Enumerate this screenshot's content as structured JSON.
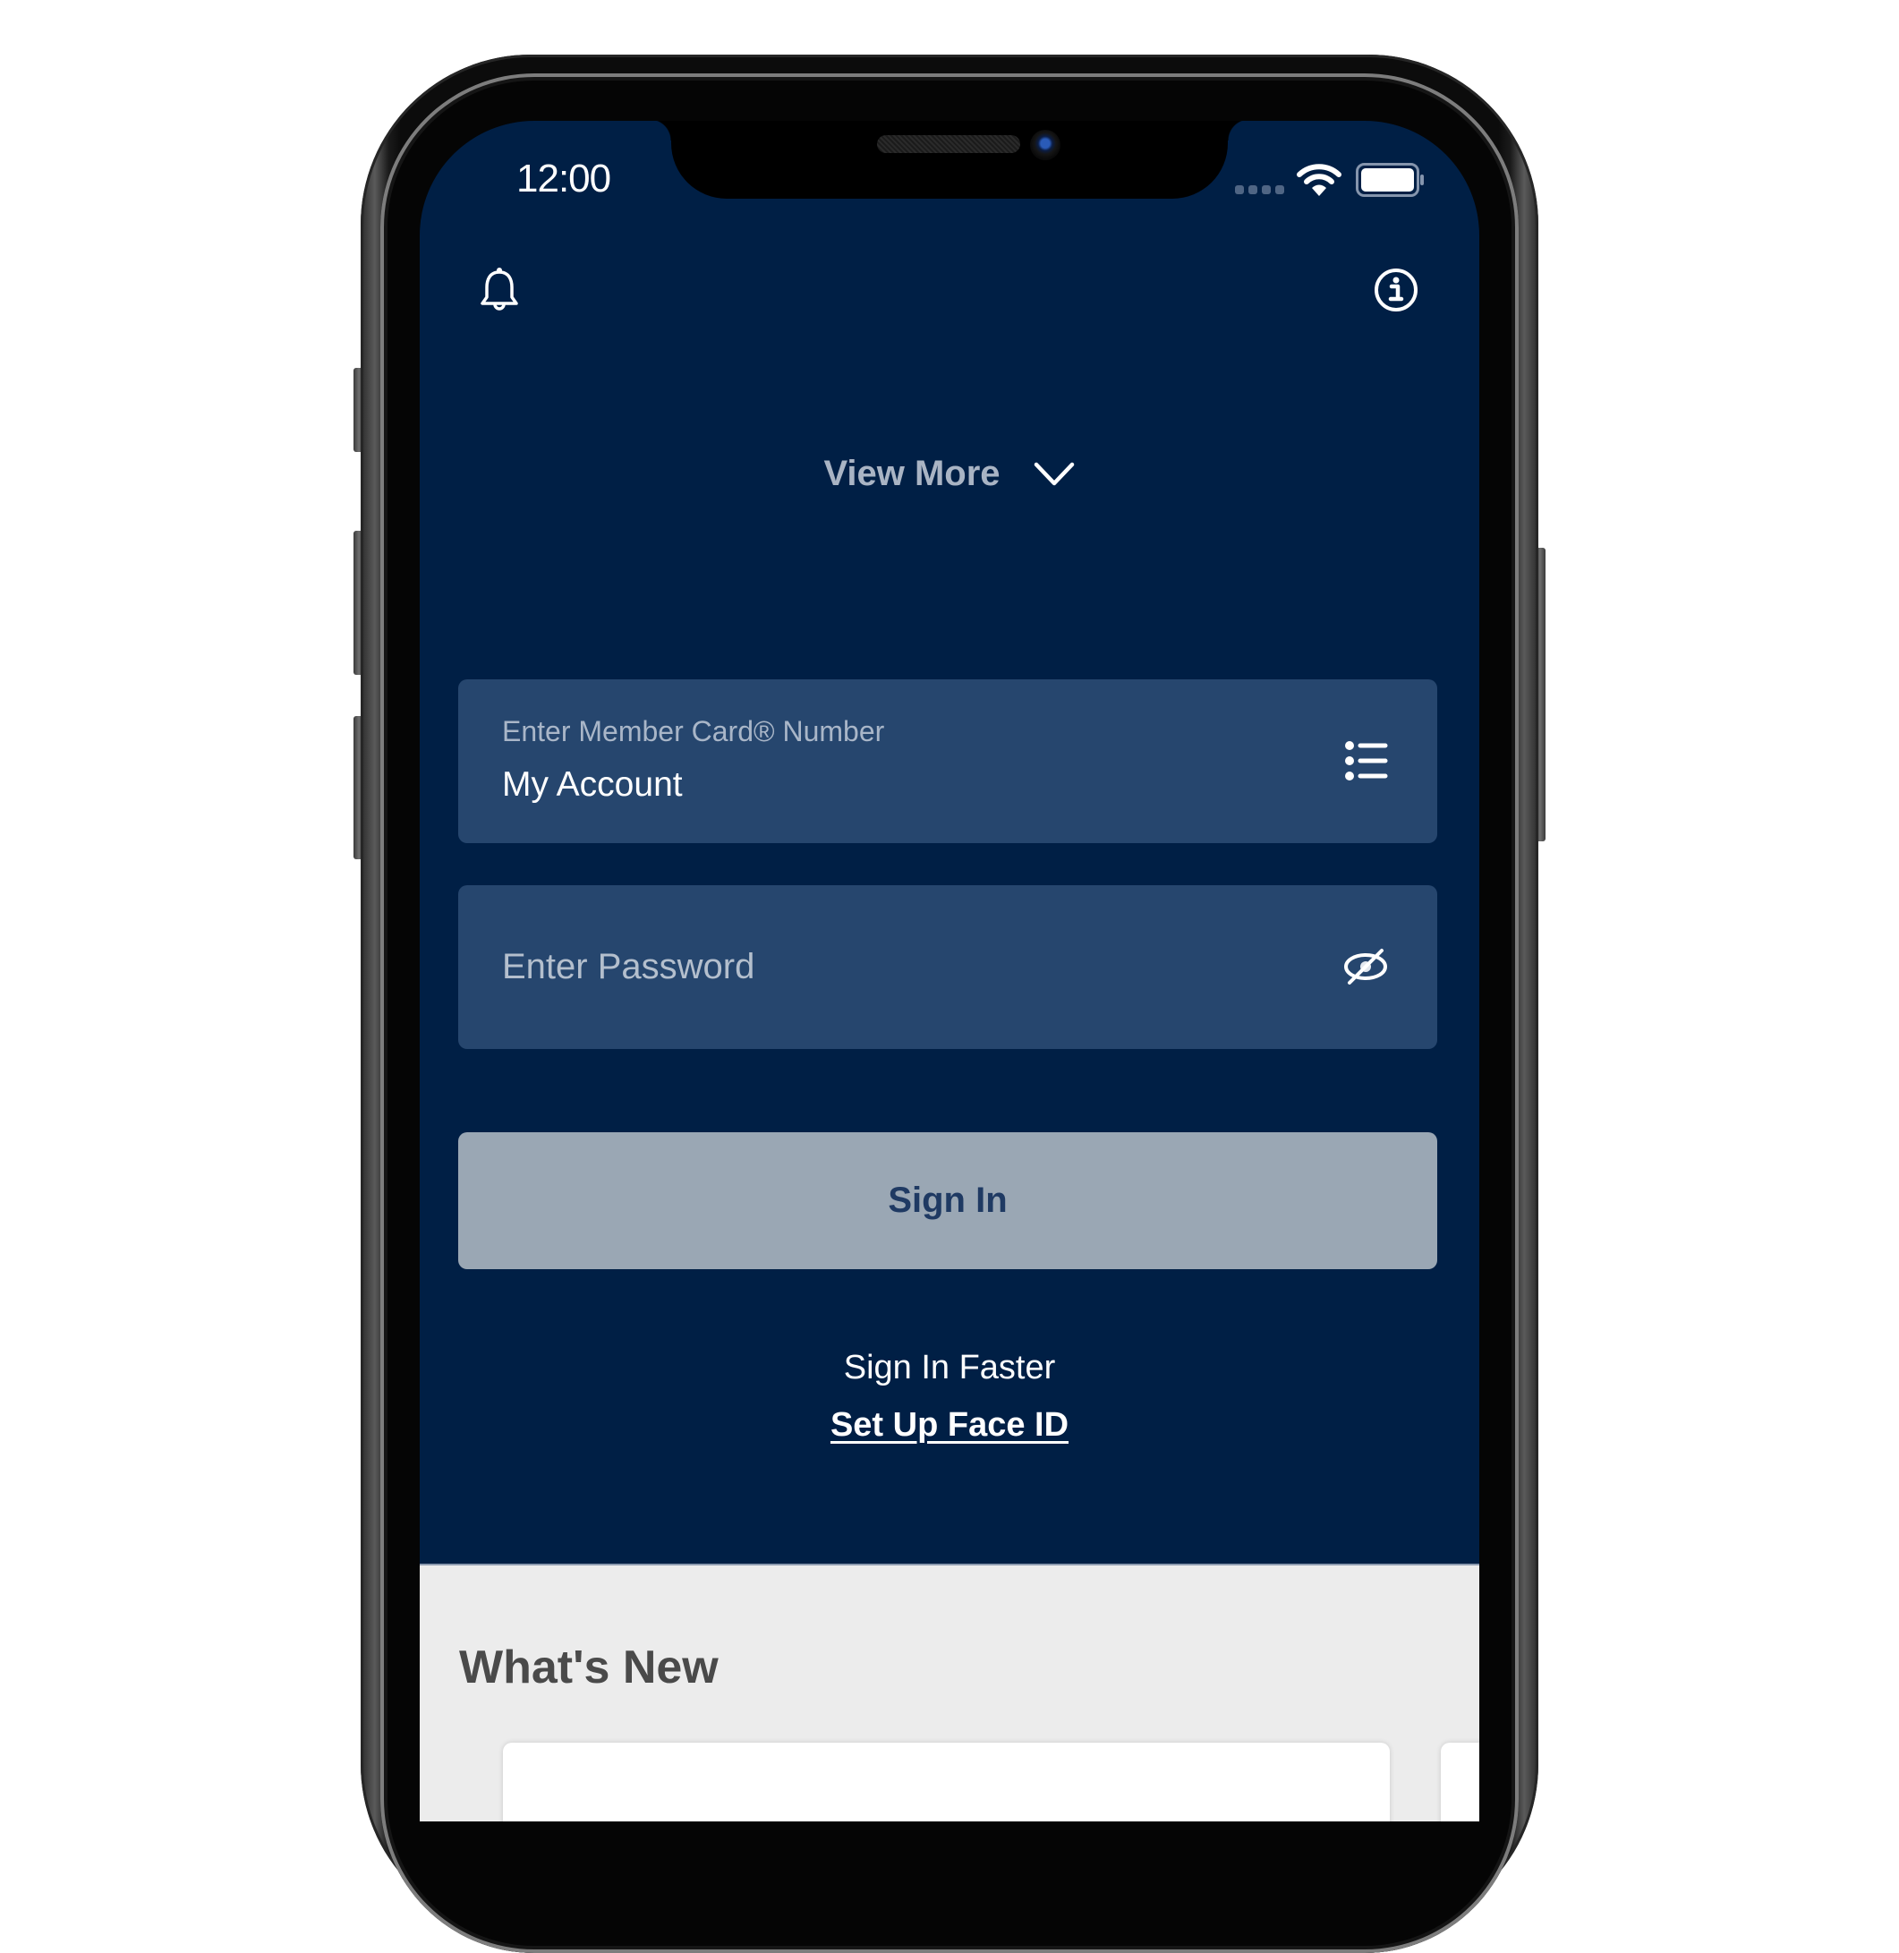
{
  "status_bar": {
    "time": "12:00",
    "signal_icon": "signal-dots-icon",
    "wifi_icon": "wifi-icon",
    "battery_icon": "battery-full-icon"
  },
  "header": {
    "notifications_icon": "bell-icon",
    "info_icon": "info-circle-icon"
  },
  "view_more": {
    "label": "View More",
    "icon": "chevron-down-icon"
  },
  "login_form": {
    "member_card": {
      "label": "Enter Member Card® Number",
      "value": "My Account",
      "icon": "list-icon"
    },
    "password": {
      "placeholder": "Enter Password",
      "value": "",
      "icon": "eye-slash-icon"
    },
    "sign_in_label": "Sign In",
    "sign_in_faster_text": "Sign In Faster",
    "face_id_link": "Set Up Face ID"
  },
  "whats_new": {
    "title": "What's New"
  },
  "colors": {
    "background_dark": "#001f45",
    "field_background": "#26466e",
    "button_disabled": "#9aa7b4",
    "button_text": "#1f3a63",
    "muted_text": "#a9b4c4",
    "section_light": "#ececec"
  }
}
